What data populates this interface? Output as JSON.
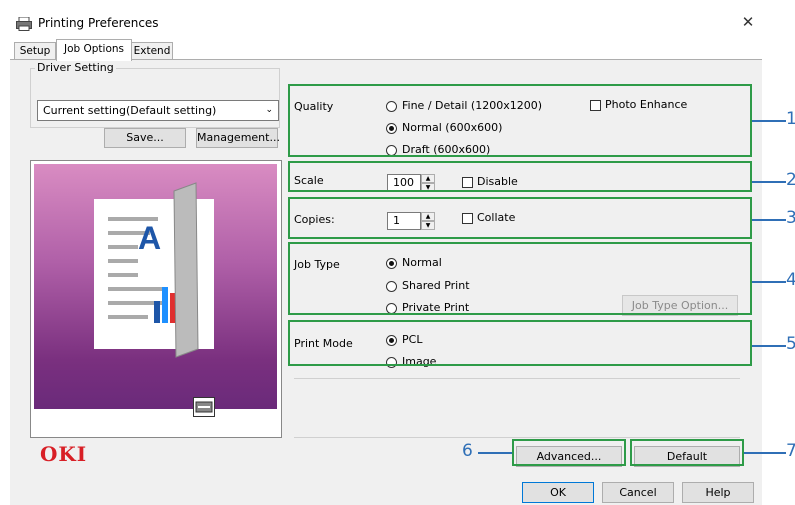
{
  "window": {
    "title": "Printing Preferences",
    "close_glyph": "✕"
  },
  "tabs": [
    {
      "label": "Setup",
      "active": false
    },
    {
      "label": "Job Options",
      "active": true
    },
    {
      "label": "Extend",
      "active": false
    }
  ],
  "driver_setting": {
    "group_label": "Driver Setting",
    "current_value": "Current setting(Default setting)",
    "save_label": "Save...",
    "management_label": "Management..."
  },
  "quality": {
    "label": "Quality",
    "options": [
      {
        "label": "Fine / Detail (1200x1200)",
        "selected": false
      },
      {
        "label": "Normal (600x600)",
        "selected": true
      },
      {
        "label": "Draft (600x600)",
        "selected": false
      }
    ],
    "photo_enhance_label": "Photo Enhance",
    "photo_enhance_checked": false
  },
  "scale": {
    "label": "Scale",
    "value": "100",
    "disable_label": "Disable",
    "disable_checked": false
  },
  "copies": {
    "label": "Copies:",
    "value": "1",
    "collate_label": "Collate",
    "collate_checked": false
  },
  "job_type": {
    "label": "Job Type",
    "options": [
      {
        "label": "Normal",
        "selected": true
      },
      {
        "label": "Shared Print",
        "selected": false
      },
      {
        "label": "Private Print",
        "selected": false
      }
    ],
    "option_button_label": "Job Type Option..."
  },
  "print_mode": {
    "label": "Print Mode",
    "options": [
      {
        "label": "PCL",
        "selected": true
      },
      {
        "label": "Image",
        "selected": false
      }
    ]
  },
  "preview": {
    "letter": "A",
    "colors": {
      "gradient_top": "#d97fb8",
      "gradient_bottom": "#6a2a7a",
      "letter": "#1e56a8"
    }
  },
  "brand": {
    "name": "OKI",
    "color": "#d81f26"
  },
  "footer_buttons": {
    "advanced_label": "Advanced...",
    "default_label": "Default",
    "ok_label": "OK",
    "cancel_label": "Cancel",
    "help_label": "Help"
  },
  "callouts": [
    "1",
    "2",
    "3",
    "4",
    "5",
    "6",
    "7"
  ],
  "colors": {
    "highlight": "#2e9b48",
    "callout": "#2f6fb6"
  }
}
